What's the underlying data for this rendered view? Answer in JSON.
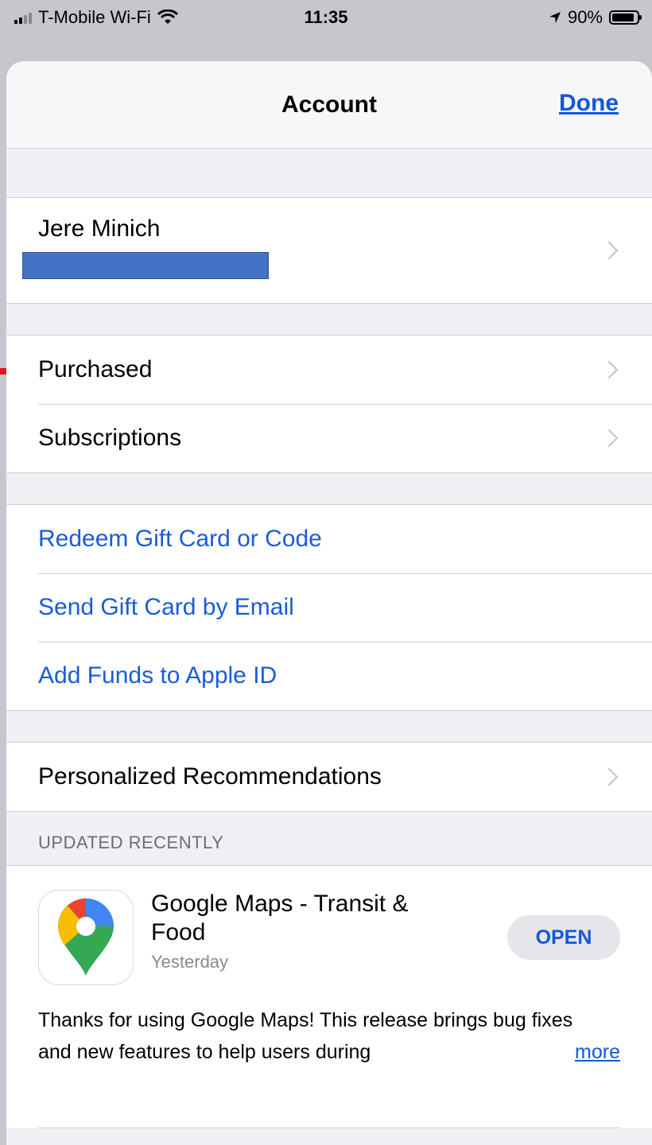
{
  "status_bar": {
    "carrier": "T-Mobile Wi-Fi",
    "time": "11:35",
    "battery": "90%",
    "icons": [
      "cellular-signal-icon",
      "wifi-icon",
      "location-arrow-icon",
      "battery-icon"
    ]
  },
  "nav": {
    "title": "Account",
    "done_label": "Done"
  },
  "account": {
    "name": "Jere Minich"
  },
  "menu_group_1": {
    "purchased": "Purchased",
    "subscriptions": "Subscriptions"
  },
  "menu_group_2": {
    "redeem": "Redeem Gift Card or Code",
    "send_gift": "Send Gift Card by Email",
    "add_funds": "Add Funds to Apple ID"
  },
  "menu_group_3": {
    "personalized": "Personalized Recommendations"
  },
  "updated_recently": {
    "header": "UPDATED RECENTLY",
    "apps": [
      {
        "name": "Google Maps - Transit & Food",
        "date": "Yesterday",
        "button": "OPEN",
        "notes": "Thanks for using Google Maps! This release brings bug fixes and new features to help users during",
        "more": "more"
      }
    ]
  },
  "colors": {
    "link_blue": "#1a5bd8",
    "redaction": "#4472c4",
    "annotation_arrow": "#e0141b"
  }
}
